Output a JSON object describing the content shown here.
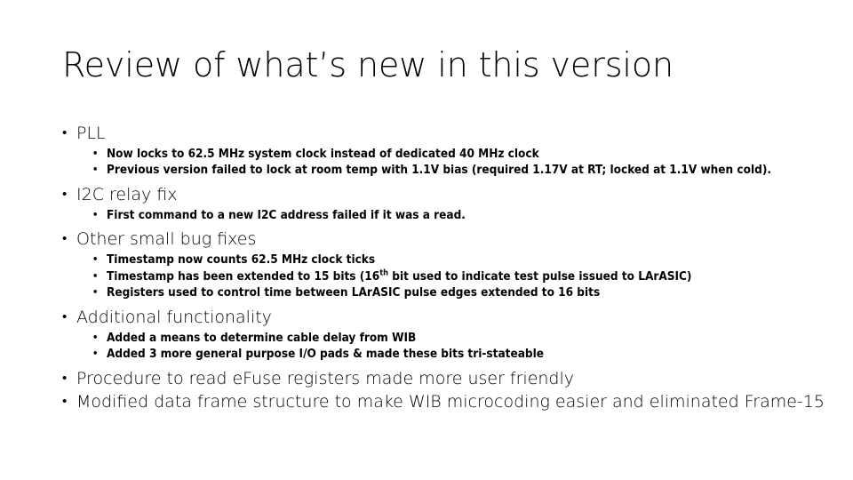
{
  "slide": {
    "title": "Review of what’s new in this version",
    "bullet_glyph": "•",
    "text_color": "#000000",
    "background_color": "#ffffff",
    "groups": [
      {
        "heading": "PLL",
        "sub": [
          "Now locks to 62.5 MHz system clock instead of dedicated 40 MHz clock",
          "Previous version failed to lock at room temp with 1.1V bias (required 1.17V at RT; locked at 1.1V when cold)."
        ]
      },
      {
        "heading": "I2C relay fix",
        "sub": [
          "First command to a new I2C address failed if it was a read."
        ]
      },
      {
        "heading": "Other small bug fixes",
        "sub": [
          "Timestamp now counts 62.5 MHz clock ticks",
          "Timestamp has been extended to 15 bits (16th bit used to indicate test pulse issued to LArASIC)",
          "Registers used to control time between LArASIC pulse edges extended to 16 bits"
        ],
        "sub_rich": {
          "1": {
            "before": "Timestamp has been extended to 15 bits (16",
            "sup": "th",
            "after": " bit used to indicate test pulse issued to LArASIC)"
          }
        }
      },
      {
        "heading": "Additional functionality",
        "sub": [
          "Added a means to determine cable delay from WIB",
          "Added 3 more general purpose I/O pads & made these bits tri-stateable"
        ]
      },
      {
        "heading": "Procedure to read eFuse registers made more user friendly",
        "sub": []
      },
      {
        "heading": "Modified data frame structure to make WIB microcoding easier and eliminated Frame-15",
        "sub": []
      }
    ]
  }
}
